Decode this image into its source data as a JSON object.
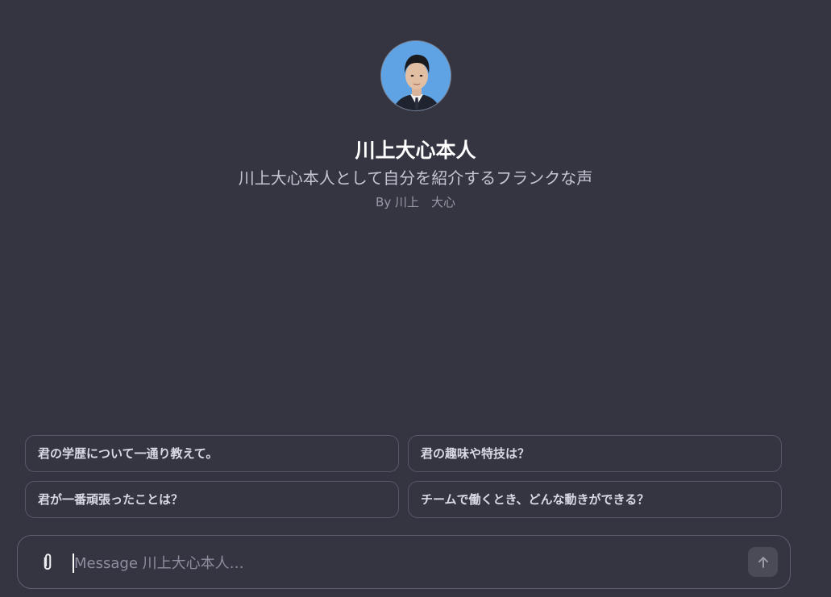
{
  "gpt": {
    "name": "川上大心本人",
    "description": "川上大心本人として自分を紹介するフランクな声",
    "author": "By 川上　大心",
    "avatar_icon": "profile-photo"
  },
  "suggestions": [
    "君の学歴について一通り教えて。",
    "君の趣味や特技は？",
    "君が一番頑張ったことは？",
    "チームで働くとき、どんな動きができる？"
  ],
  "composer": {
    "placeholder": "Message 川上大心本人…",
    "value": "",
    "attach_icon": "paperclip-icon",
    "send_icon": "arrow-up-icon"
  },
  "colors": {
    "background": "#343541",
    "border": "#565869",
    "send_button": "#4a4b57",
    "avatar_bg": "#5fa3e4"
  }
}
